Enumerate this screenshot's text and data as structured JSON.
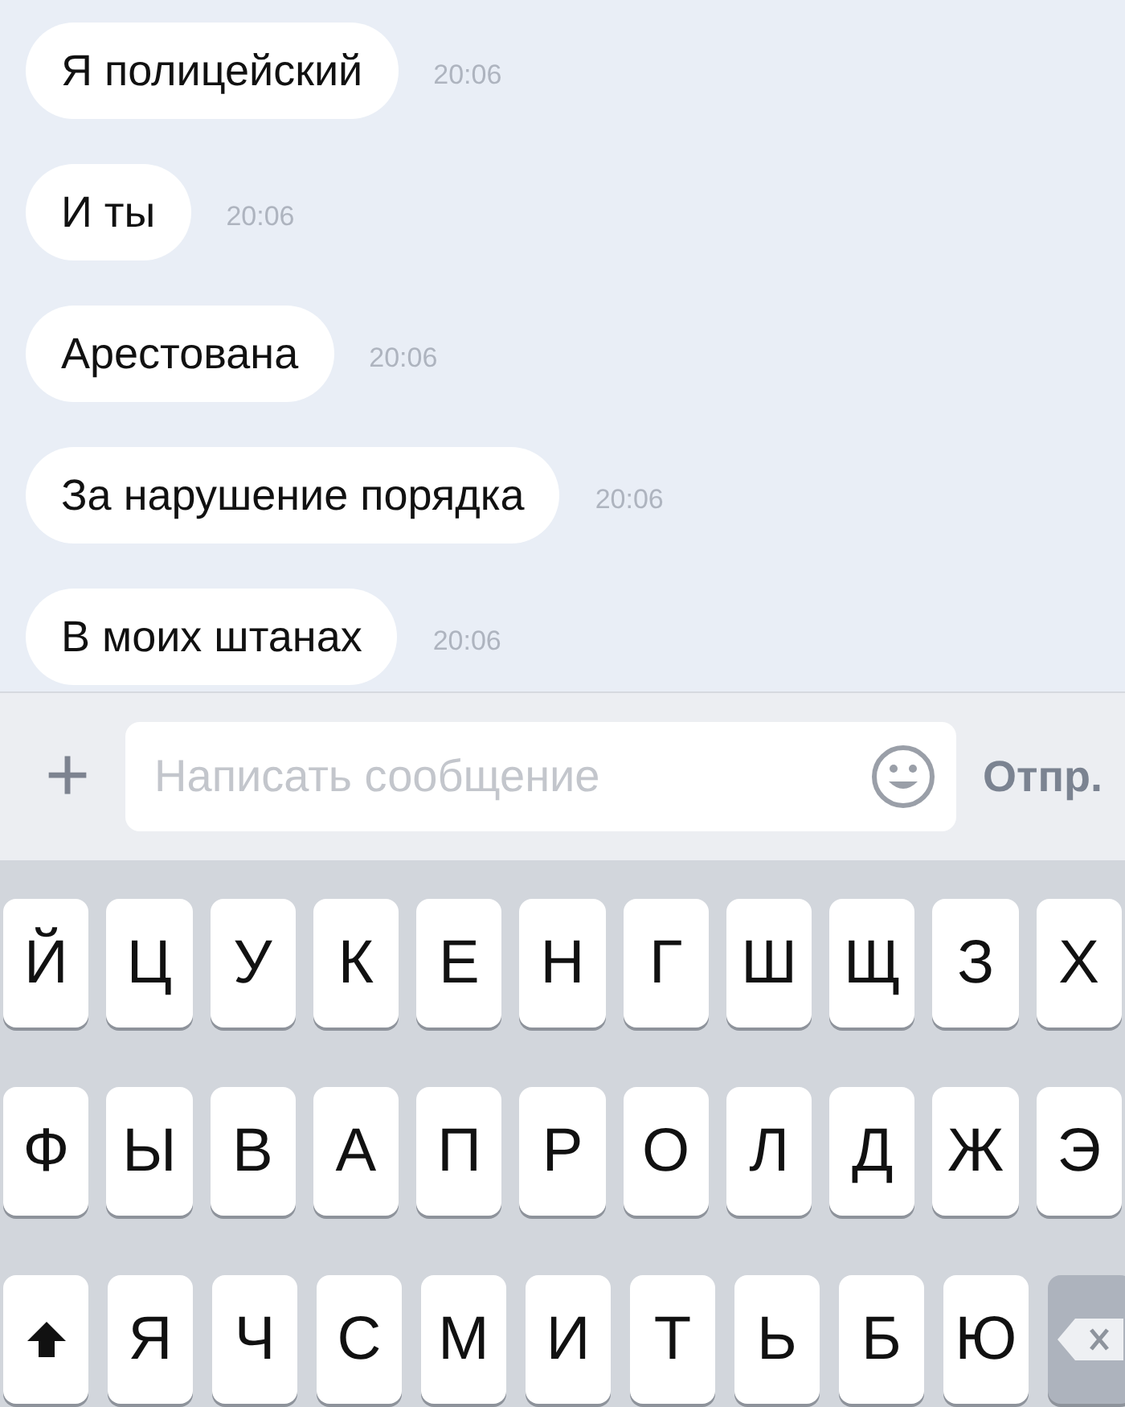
{
  "messages": [
    {
      "text": "Я полицейский",
      "time": "20:06"
    },
    {
      "text": "И ты",
      "time": "20:06"
    },
    {
      "text": "Арестована",
      "time": "20:06"
    },
    {
      "text": "За нарушение порядка",
      "time": "20:06"
    },
    {
      "text": "В моих штанах",
      "time": "20:06"
    }
  ],
  "compose": {
    "plus": "+",
    "placeholder": "Написать сообщение",
    "send": "Отпр."
  },
  "keyboard": {
    "rows": [
      [
        {
          "kind": "letter",
          "label": "Й"
        },
        {
          "kind": "letter",
          "label": "Ц"
        },
        {
          "kind": "letter",
          "label": "У"
        },
        {
          "kind": "letter",
          "label": "К"
        },
        {
          "kind": "letter",
          "label": "Е"
        },
        {
          "kind": "letter",
          "label": "Н"
        },
        {
          "kind": "letter",
          "label": "Г"
        },
        {
          "kind": "letter",
          "label": "Ш"
        },
        {
          "kind": "letter",
          "label": "Щ"
        },
        {
          "kind": "letter",
          "label": "З"
        },
        {
          "kind": "letter",
          "label": "Х"
        }
      ],
      [
        {
          "kind": "letter",
          "label": "Ф"
        },
        {
          "kind": "letter",
          "label": "Ы"
        },
        {
          "kind": "letter",
          "label": "В"
        },
        {
          "kind": "letter",
          "label": "А"
        },
        {
          "kind": "letter",
          "label": "П"
        },
        {
          "kind": "letter",
          "label": "Р"
        },
        {
          "kind": "letter",
          "label": "О"
        },
        {
          "kind": "letter",
          "label": "Л"
        },
        {
          "kind": "letter",
          "label": "Д"
        },
        {
          "kind": "letter",
          "label": "Ж"
        },
        {
          "kind": "letter",
          "label": "Э"
        }
      ],
      [
        {
          "kind": "shift"
        },
        {
          "kind": "letter",
          "label": "Я"
        },
        {
          "kind": "letter",
          "label": "Ч"
        },
        {
          "kind": "letter",
          "label": "С"
        },
        {
          "kind": "letter",
          "label": "М"
        },
        {
          "kind": "letter",
          "label": "И"
        },
        {
          "kind": "letter",
          "label": "Т"
        },
        {
          "kind": "letter",
          "label": "Ь"
        },
        {
          "kind": "letter",
          "label": "Б"
        },
        {
          "kind": "letter",
          "label": "Ю"
        },
        {
          "kind": "delete"
        }
      ]
    ]
  }
}
